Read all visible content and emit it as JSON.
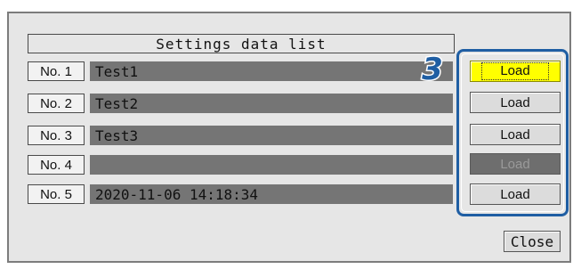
{
  "dialog": {
    "title": "Settings data list",
    "step_marker": "3",
    "close_label": "Close"
  },
  "rows": [
    {
      "number": "No. 1",
      "name": "Test1",
      "load_label": "Load",
      "load_state": "selected"
    },
    {
      "number": "No. 2",
      "name": "Test2",
      "load_label": "Load",
      "load_state": "normal"
    },
    {
      "number": "No. 3",
      "name": "Test3",
      "load_label": "Load",
      "load_state": "normal"
    },
    {
      "number": "No. 4",
      "name": "",
      "load_label": "Load",
      "load_state": "disabled"
    },
    {
      "number": "No. 5",
      "name": "2020-11-06 14:18:34",
      "load_label": "Load",
      "load_state": "normal"
    }
  ],
  "colors": {
    "panel_background": "#e6e6e6",
    "name_field": "#757575",
    "selected_button": "#ffff00",
    "disabled_button": "#6e6e6e",
    "callout_frame": "#1f5ea3"
  }
}
